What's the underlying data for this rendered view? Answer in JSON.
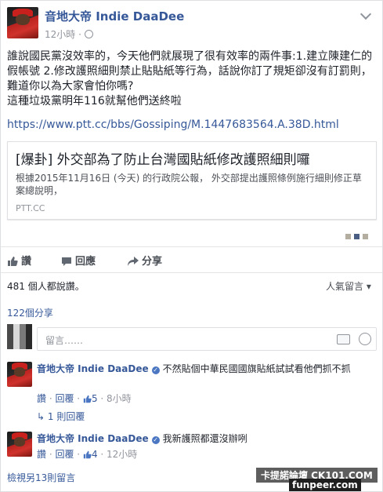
{
  "post": {
    "author": "音地大帝 Indie DaaDee",
    "time": "12小時",
    "body_lines": [
      "誰說國民黨沒效率的，今天他們就展現了很有效率的兩件事:1.建立陳建仁的假帳號 2.修改護照細則禁止貼貼紙等行為，話說你訂了規矩卻沒有訂罰則，難道你以為大家會怕你嗎?",
      "這種垃圾黨明年116就幫他們送終啦"
    ],
    "link_url": "https://www.ptt.cc/bbs/Gossiping/M.1447683564.A.38D.html",
    "link_card": {
      "title": "[爆卦] 外交部為了防止台灣國貼紙修改護照細則囉",
      "description": "根據2015年11月16日 (今天) 的行政院公報， 外交部提出護照條例施行細則修正草案總說明，",
      "domain": "PTT.CC"
    }
  },
  "actions": {
    "like": "讚",
    "comment": "回應",
    "share": "分享"
  },
  "stats": {
    "likes_text": "481 個人都說讚。",
    "sort_label": "人氣留言",
    "shares_text": "122個分享"
  },
  "comment_box": {
    "placeholder": "留言……"
  },
  "comments": [
    {
      "author": "音地大帝 Indie DaaDee",
      "text": "不然貼個中華民國國旗貼紙試試看他們抓不抓",
      "like": "讚",
      "reply": "回覆",
      "like_count": "5",
      "time": "8小時",
      "replies_link": "1 則回覆"
    },
    {
      "author": "音地大帝 Indie DaaDee",
      "text": "我新護照都還沒辦咧",
      "like": "讚",
      "reply": "回覆",
      "like_count": "4",
      "time": "12小時"
    }
  ],
  "more_comments": "檢視另13則留言",
  "watermark": {
    "line1": "卡提諾論壇 CK101.COM",
    "line2": "funpeer.com"
  },
  "colors": {
    "link_blue": "#365899",
    "meta_gray": "#90949c",
    "border": "#dddfe2"
  }
}
